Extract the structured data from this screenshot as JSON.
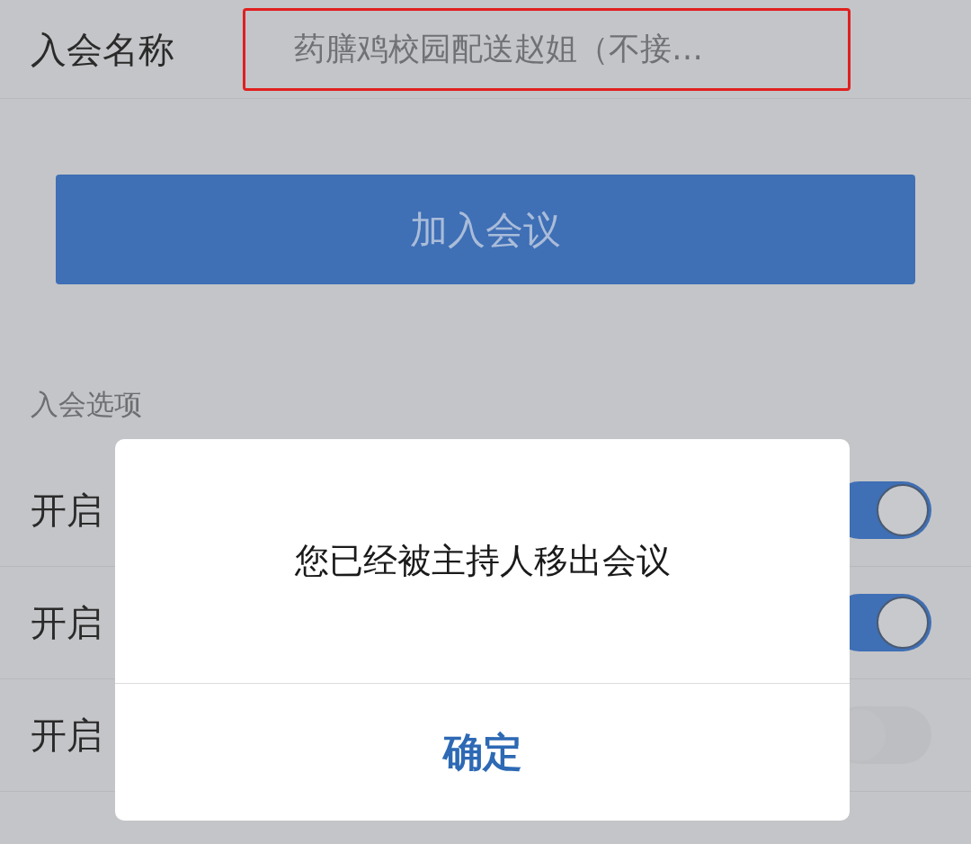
{
  "name_field": {
    "label": "入会名称",
    "value": "药膳鸡校园配送赵姐（不接…",
    "highlighted": true
  },
  "join_button": {
    "label": "加入会议"
  },
  "options_section": {
    "title": "入会选项"
  },
  "options": [
    {
      "label": "开启",
      "on": true
    },
    {
      "label": "开启",
      "on": true
    },
    {
      "label": "开启",
      "on": false
    }
  ],
  "dialog": {
    "message": "您已经被主持人移出会议",
    "confirm": "确定"
  }
}
